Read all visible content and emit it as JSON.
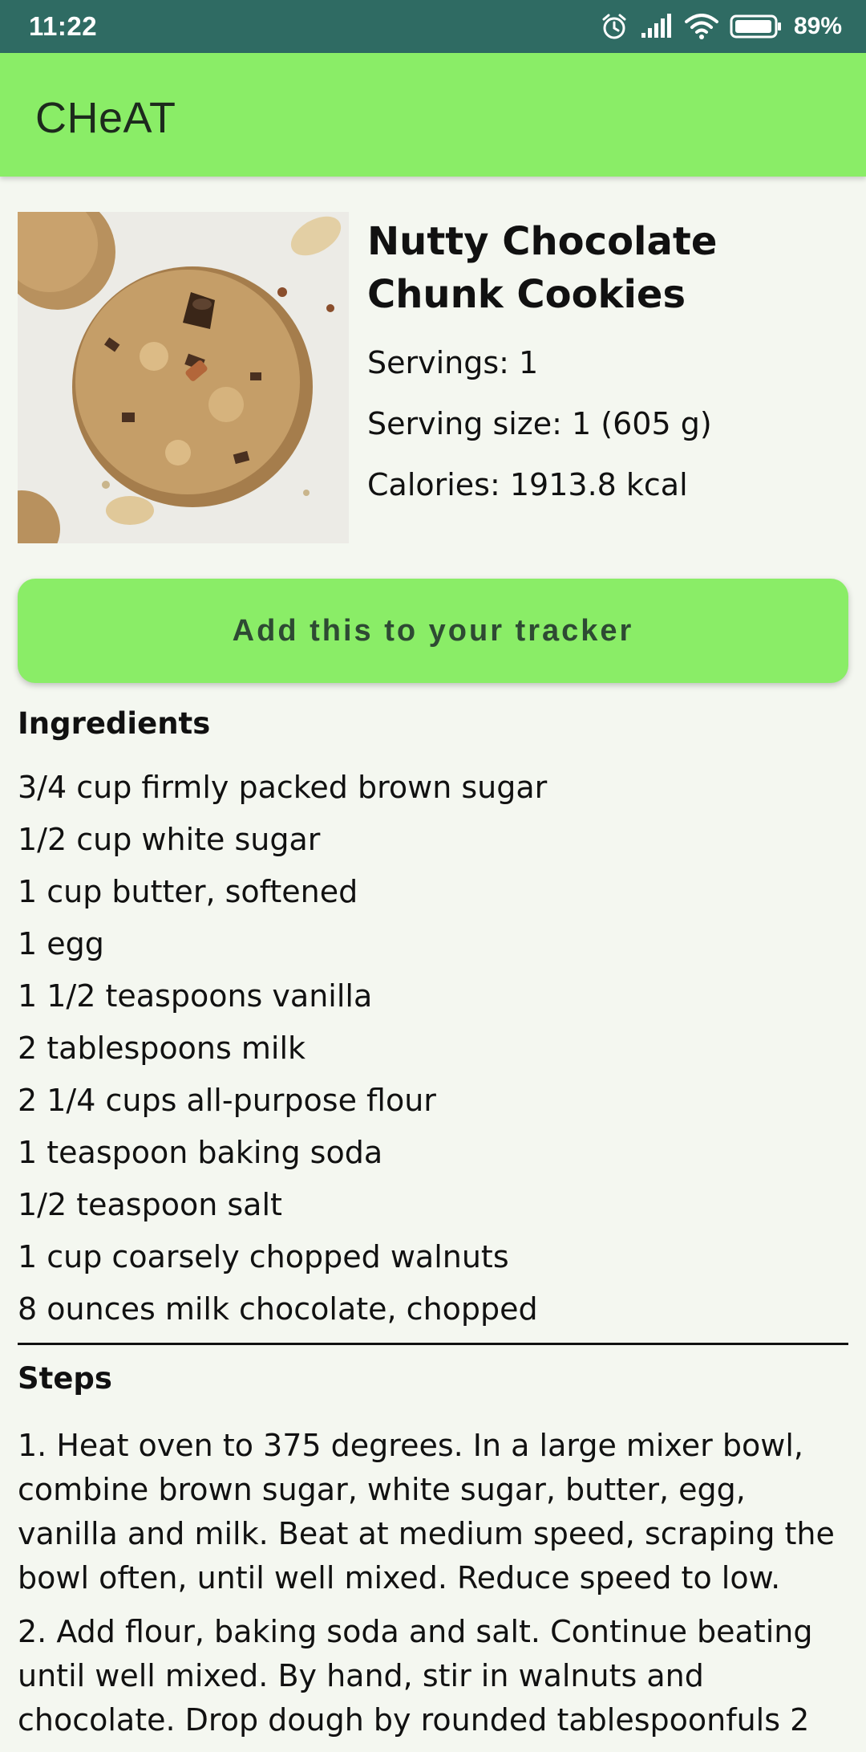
{
  "status_bar": {
    "time": "11:22",
    "battery": "89%",
    "icons": [
      "alarm-icon",
      "signal-icon",
      "wifi-icon",
      "battery-icon"
    ]
  },
  "app_bar": {
    "title": "CHeAT"
  },
  "recipe": {
    "title": "Nutty Chocolate Chunk Cookies",
    "servings": "Servings: 1",
    "serving_size": "Serving size: 1 (605 g)",
    "calories": "Calories: 1913.8 kcal"
  },
  "actions": {
    "add_tracker_label": "Add this to your tracker"
  },
  "ingredients": {
    "heading": "Ingredients",
    "items": [
      "3/4 cup firmly packed brown sugar",
      "1/2 cup white sugar",
      "1 cup butter, softened",
      "1 egg",
      "1 1/2 teaspoons vanilla",
      "2 tablespoons milk",
      "2 1/4 cups all-purpose flour",
      "1 teaspoon baking soda",
      "1/2 teaspoon salt",
      "1 cup coarsely chopped walnuts",
      "8 ounces milk chocolate, chopped"
    ]
  },
  "steps": {
    "heading": "Steps",
    "items": [
      "1. Heat oven to 375 degrees. In a large mixer bowl, combine brown sugar, white sugar, butter, egg, vanilla and milk. Beat at medium speed, scraping the bowl often, until well mixed. Reduce speed to low.",
      "2. Add flour, baking soda and salt. Continue beating until well mixed. By hand, stir in walnuts and chocolate. Drop dough by rounded tablespoonfuls 2"
    ]
  },
  "colors": {
    "status_bar": "#2f6b63",
    "accent": "#8aed67",
    "background": "#f4f7f0"
  }
}
